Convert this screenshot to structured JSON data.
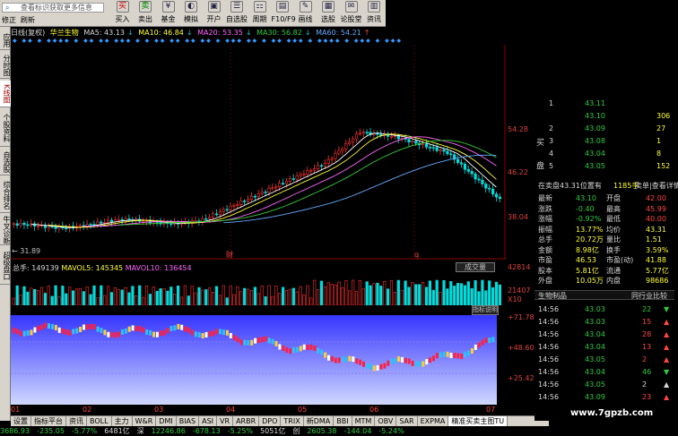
{
  "search": {
    "placeholder": "查看标识获取更多信息"
  },
  "toolbar": [
    {
      "label": "买入",
      "icon": "买",
      "name": "buy-button"
    },
    {
      "label": "卖出",
      "icon": "卖",
      "name": "sell-button"
    },
    {
      "label": "基金",
      "icon": "¥",
      "name": "fund-button"
    },
    {
      "label": "模拟",
      "icon": "◐",
      "name": "simulate-button"
    },
    {
      "label": "开户",
      "icon": "▣",
      "name": "open-account-button"
    },
    {
      "label": "自选股",
      "icon": "☰",
      "name": "watchlist-button"
    },
    {
      "label": "周期",
      "icon": "⚏",
      "name": "period-button"
    },
    {
      "label": "F10/F9",
      "icon": "▤",
      "name": "f10-button"
    },
    {
      "label": "画线",
      "icon": "✎",
      "name": "draw-line-button"
    },
    {
      "label": "选股",
      "icon": "▦",
      "name": "stock-pick-button"
    },
    {
      "label": "论股堂",
      "icon": "✉",
      "name": "forum-button"
    },
    {
      "label": "资讯",
      "icon": "▥",
      "name": "news-button"
    }
  ],
  "quick": [
    "修正",
    "刷新"
  ],
  "sidetabs": [
    "应用",
    "分时图",
    "K线图",
    "个股资料",
    "自选股",
    "综合排名",
    "牛叉诊断",
    "超级盘口"
  ],
  "header": {
    "title": "日线(复权)",
    "stock": "华兰生物",
    "ma5": "MA5: 43.13",
    "ma10": "MA10: 46.84",
    "ma20": "MA20: 53.35",
    "ma30": "MA30: 56.82",
    "ma60": "MA60: 54.21"
  },
  "price_axis": [
    "54.28",
    "46.22",
    "38.04"
  ],
  "low_marker": "← 31.89",
  "marks": {
    "cai": "财",
    "q": "q"
  },
  "volume": {
    "total": "总手: 149139",
    "mavol5": "MAVOL5: 145345",
    "mavol10": "MAVOL10: 136454",
    "button": "成交量",
    "axis_top": "42814",
    "axis_mid": "21407",
    "axis_unit": "X10"
  },
  "indicator": {
    "button": "指标说明",
    "axis": [
      "+71.78",
      "+48.60",
      "+25.42"
    ]
  },
  "months": [
    "01",
    "02",
    "03",
    "04",
    "05",
    "06",
    "07"
  ],
  "bottom_tabs": [
    "设置",
    "指标平台",
    "资讯",
    "BOLL",
    "主力",
    "W&R",
    "DMI",
    "BIAS",
    "ASI",
    "VR",
    "ARBR",
    "DPO",
    "TRIX",
    "新DMA",
    "BBI",
    "MTM",
    "OBV",
    "SAR",
    "EXPMA",
    "精准买卖主图TU"
  ],
  "status": [
    "3686.93",
    "-235.05",
    "-5.77%",
    "6481亿",
    "深",
    "12246.86",
    "-678.13",
    "-5.25%",
    "5051亿",
    "创",
    "2605.38",
    "-144.04",
    "-5.24%"
  ],
  "orderbook": {
    "sell": [
      {
        "lvl": "1",
        "price": "43.11",
        "vol": ""
      },
      {
        "lvl": "",
        "price": "43.10",
        "vol": "306"
      }
    ],
    "buy": [
      {
        "lvl": "2",
        "price": "43.09",
        "vol": "27"
      },
      {
        "lvl": "3",
        "price": "43.08",
        "vol": "1"
      },
      {
        "lvl": "4",
        "price": "43.04",
        "vol": "8"
      },
      {
        "lvl": "5",
        "price": "43.05",
        "vol": "152"
      }
    ],
    "buy_label": "买",
    "pan_label": "盘"
  },
  "inplay": {
    "label": "在卖盘43.31位置有",
    "vol": "1185手",
    "tail": "卖单|查看详情"
  },
  "quote": [
    [
      "最新",
      "43.10",
      "开盘",
      "42.00"
    ],
    [
      "涨跌",
      "-0.40",
      "最高",
      "45.99"
    ],
    [
      "涨幅",
      "-0.92%",
      "最低",
      "40.00"
    ],
    [
      "振幅",
      "13.77%",
      "均价",
      "43.31"
    ],
    [
      "总手",
      "20.72万",
      "量比",
      "1.51"
    ],
    [
      "金额",
      "8.98亿",
      "换手",
      "3.59%"
    ],
    [
      "市盈",
      "46.53",
      "市盈(动)",
      "41.88"
    ],
    [
      "股本",
      "5.81亿",
      "流通",
      "5.77亿"
    ],
    [
      "外盘",
      "10.05万",
      "内盘",
      "98686"
    ]
  ],
  "industry": {
    "left": "生物制品",
    "right": "同行业比较"
  },
  "ticks": [
    {
      "t": "14:56",
      "p": "43.03",
      "v": "22",
      "dir": "down"
    },
    {
      "t": "14:56",
      "p": "43.03",
      "v": "15",
      "dir": "up"
    },
    {
      "t": "14:56",
      "p": "43.04",
      "v": "28",
      "dir": "up"
    },
    {
      "t": "14:56",
      "p": "43.04",
      "v": "13",
      "dir": "up"
    },
    {
      "t": "14:56",
      "p": "43.05",
      "v": "2",
      "dir": "up"
    },
    {
      "t": "14:56",
      "p": "43.04",
      "v": "46",
      "dir": "down"
    },
    {
      "t": "14:56",
      "p": "43.05",
      "v": "2",
      "dir": "white"
    },
    {
      "t": "14:56",
      "p": "43.09",
      "v": "23",
      "dir": "up"
    }
  ],
  "watermark": "www.7gpzb.com"
}
